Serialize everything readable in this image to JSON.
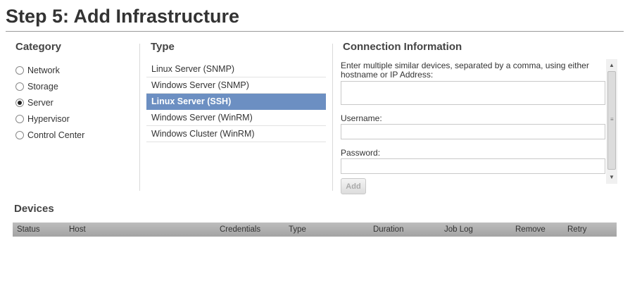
{
  "page": {
    "title": "Step 5: Add Infrastructure"
  },
  "category": {
    "header": "Category",
    "options": [
      {
        "label": "Network",
        "checked": false
      },
      {
        "label": "Storage",
        "checked": false
      },
      {
        "label": "Server",
        "checked": true
      },
      {
        "label": "Hypervisor",
        "checked": false
      },
      {
        "label": "Control Center",
        "checked": false
      }
    ]
  },
  "type": {
    "header": "Type",
    "items": [
      {
        "label": "Linux Server (SNMP)",
        "selected": false
      },
      {
        "label": "Windows Server (SNMP)",
        "selected": false
      },
      {
        "label": "Linux Server (SSH)",
        "selected": true
      },
      {
        "label": "Windows Server (WinRM)",
        "selected": false
      },
      {
        "label": "Windows Cluster (WinRM)",
        "selected": false
      }
    ]
  },
  "connection": {
    "header": "Connection Information",
    "description": "Enter multiple similar devices, separated by a comma, using either hostname or IP Address:",
    "hosts_value": "",
    "username_label": "Username:",
    "username_value": "",
    "password_label": "Password:",
    "password_value": "",
    "add_label": "Add"
  },
  "devices": {
    "title": "Devices",
    "columns": [
      "Status",
      "Host",
      "Credentials",
      "Type",
      "Duration",
      "Job Log",
      "Remove",
      "Retry"
    ]
  },
  "colors": {
    "selected_bg": "#6c8fc2",
    "table_header": "#b0b0b0"
  },
  "icons": {
    "scroll_up": "triangle-up",
    "scroll_down": "triangle-down",
    "grip": "grip-lines"
  }
}
